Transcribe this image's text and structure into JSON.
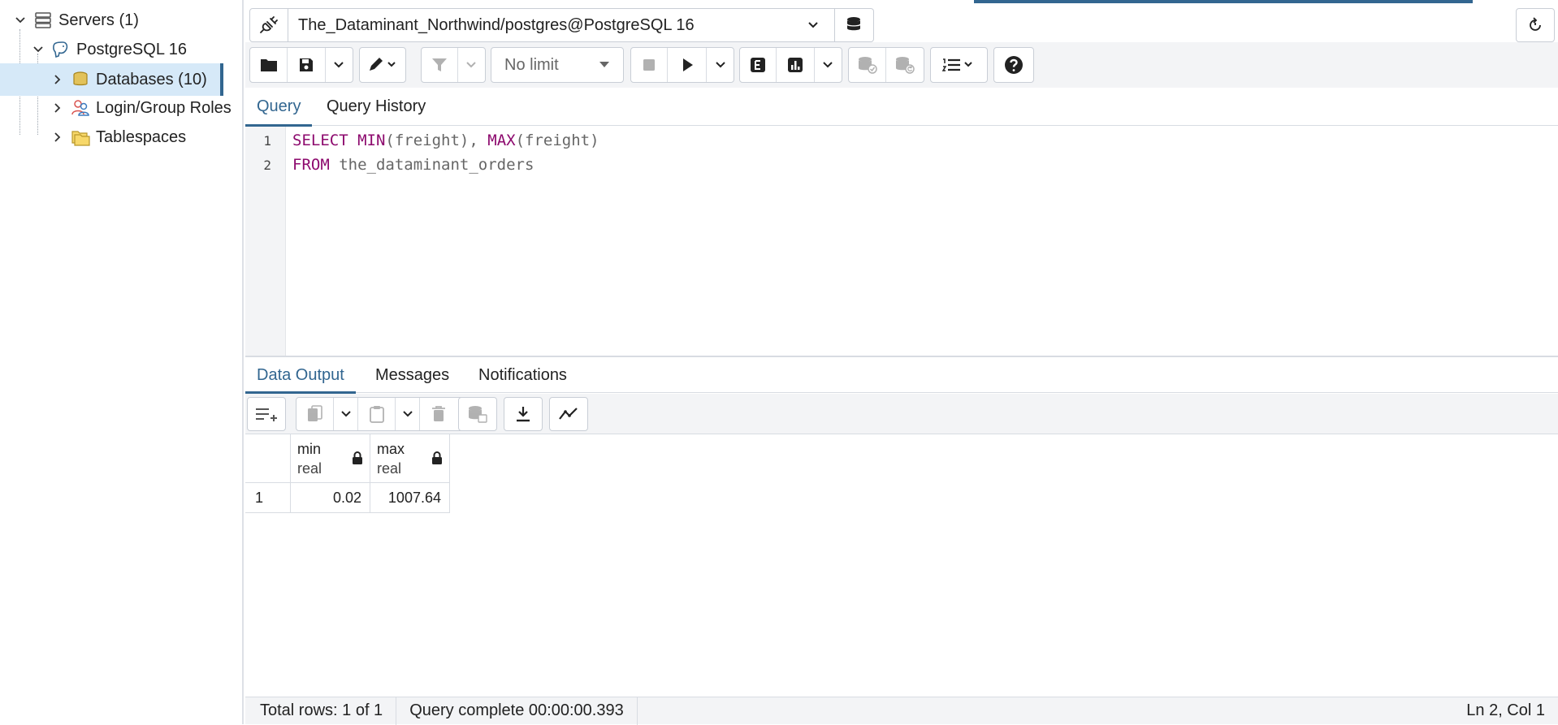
{
  "tree": {
    "items": [
      {
        "label": "Servers (1)",
        "icon": "servers-icon"
      },
      {
        "label": "PostgreSQL 16",
        "icon": "postgres-elephant-icon"
      },
      {
        "label": "Databases (10)",
        "icon": "databases-icon"
      },
      {
        "label": "Login/Group Roles",
        "icon": "roles-icon"
      },
      {
        "label": "Tablespaces",
        "icon": "tablespaces-icon"
      }
    ]
  },
  "connection": {
    "label": "The_Dataminant_Northwind/postgres@PostgreSQL 16"
  },
  "toolbar": {
    "limit_label": "No limit"
  },
  "query_tabs": [
    {
      "label": "Query"
    },
    {
      "label": "Query History"
    }
  ],
  "editor": {
    "line_numbers": [
      "1",
      "2"
    ],
    "line1": {
      "k1": "SELECT",
      "f1": "MIN",
      "a1": "(freight), ",
      "f2": "MAX",
      "a2": "(freight)"
    },
    "line2": {
      "k1": "FROM",
      "rest": " the_dataminant_orders"
    }
  },
  "output_tabs": [
    {
      "label": "Data Output"
    },
    {
      "label": "Messages"
    },
    {
      "label": "Notifications"
    }
  ],
  "grid": {
    "columns": [
      {
        "name": "min",
        "type": "real"
      },
      {
        "name": "max",
        "type": "real"
      }
    ],
    "rows": [
      {
        "num": "1",
        "cells": [
          "0.02",
          "1007.64"
        ]
      }
    ]
  },
  "status": {
    "total_rows": "Total rows: 1 of 1",
    "query_complete": "Query complete 00:00:00.393",
    "cursor": "Ln 2, Col 1"
  },
  "colors": {
    "accent": "#326690",
    "keyword": "#8d0a6e",
    "selection": "#d6e9f8"
  }
}
